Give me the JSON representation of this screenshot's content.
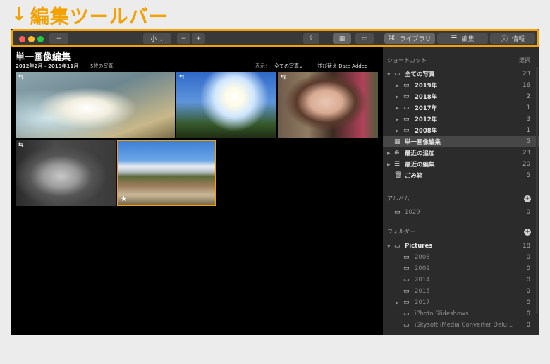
{
  "annotation": {
    "arrow": "↓",
    "title": "編集ツールバー",
    "color": "#f2a100"
  },
  "toolbar": {
    "add_label": "+",
    "size_label": "小 ⌄",
    "zoom_out": "−",
    "zoom_in": "+",
    "share_icon": "⇪",
    "grid_icon": "▦",
    "single_icon": "▭",
    "library_icon": "⌘",
    "library_label": "ライブラリ",
    "edit_icon": "☰",
    "edit_label": "編集",
    "info_icon": "ⓘ",
    "info_label": "情報"
  },
  "content": {
    "title": "単一画像編集",
    "date_range": "2012年2月 - 2019年11月",
    "count": "5枚の写真",
    "display_label": "表示：",
    "display_value": "全ての写真⌄",
    "sort": "並び替え Date Added",
    "thumbnails": [
      {
        "badge": "⇆",
        "star": ""
      },
      {
        "badge": "⇆",
        "star": ""
      },
      {
        "badge": "⇆",
        "star": ""
      },
      {
        "badge": "⇆",
        "star": ""
      },
      {
        "badge": "",
        "star": "★"
      }
    ]
  },
  "sidebar": {
    "shortcuts": {
      "title": "ショートカット",
      "select": "選択",
      "items": [
        {
          "label": "全ての写真",
          "count": "23",
          "triangle": "▼",
          "icon": "▭"
        },
        {
          "label": "2019年",
          "count": "16",
          "triangle": "▶",
          "icon": "▭"
        },
        {
          "label": "2018年",
          "count": "2",
          "triangle": "▶",
          "icon": "▭"
        },
        {
          "label": "2017年",
          "count": "1",
          "triangle": "▶",
          "icon": "▭"
        },
        {
          "label": "2012年",
          "count": "3",
          "triangle": "▶",
          "icon": "▭"
        },
        {
          "label": "2008年",
          "count": "1",
          "triangle": "▶",
          "icon": "▭"
        },
        {
          "label": "単一画像編集",
          "count": "5",
          "triangle": "",
          "icon": "▦"
        },
        {
          "label": "最近の追加",
          "count": "23",
          "triangle": "▶",
          "icon": "⊕"
        },
        {
          "label": "最近の編集",
          "count": "20",
          "triangle": "▶",
          "icon": "☰"
        },
        {
          "label": "ごみ箱",
          "count": "5",
          "triangle": "",
          "icon": "🗑"
        }
      ]
    },
    "albums": {
      "title": "アルバム",
      "plus": "+",
      "items": [
        {
          "label": "1029",
          "count": "0",
          "icon": "▭"
        }
      ]
    },
    "folders": {
      "title": "フォルダー",
      "plus": "+",
      "items": [
        {
          "label": "Pictures",
          "count": "18",
          "triangle": "▼",
          "icon": "▭"
        },
        {
          "label": "2008",
          "count": "0",
          "triangle": "",
          "icon": "▭"
        },
        {
          "label": "2009",
          "count": "0",
          "triangle": "",
          "icon": "▭"
        },
        {
          "label": "2014",
          "count": "0",
          "triangle": "",
          "icon": "▭"
        },
        {
          "label": "2015",
          "count": "0",
          "triangle": "",
          "icon": "▭"
        },
        {
          "label": "2017",
          "count": "0",
          "triangle": "▶",
          "icon": "▭"
        },
        {
          "label": "iPhoto Slideshows",
          "count": "0",
          "triangle": "",
          "icon": "▭"
        },
        {
          "label": "iSkysoft iMedia Converter Delu...",
          "count": "0",
          "triangle": "",
          "icon": "▭"
        }
      ]
    }
  },
  "colors": {
    "accent": "#f2a100",
    "selection_border": "#f2a100"
  }
}
